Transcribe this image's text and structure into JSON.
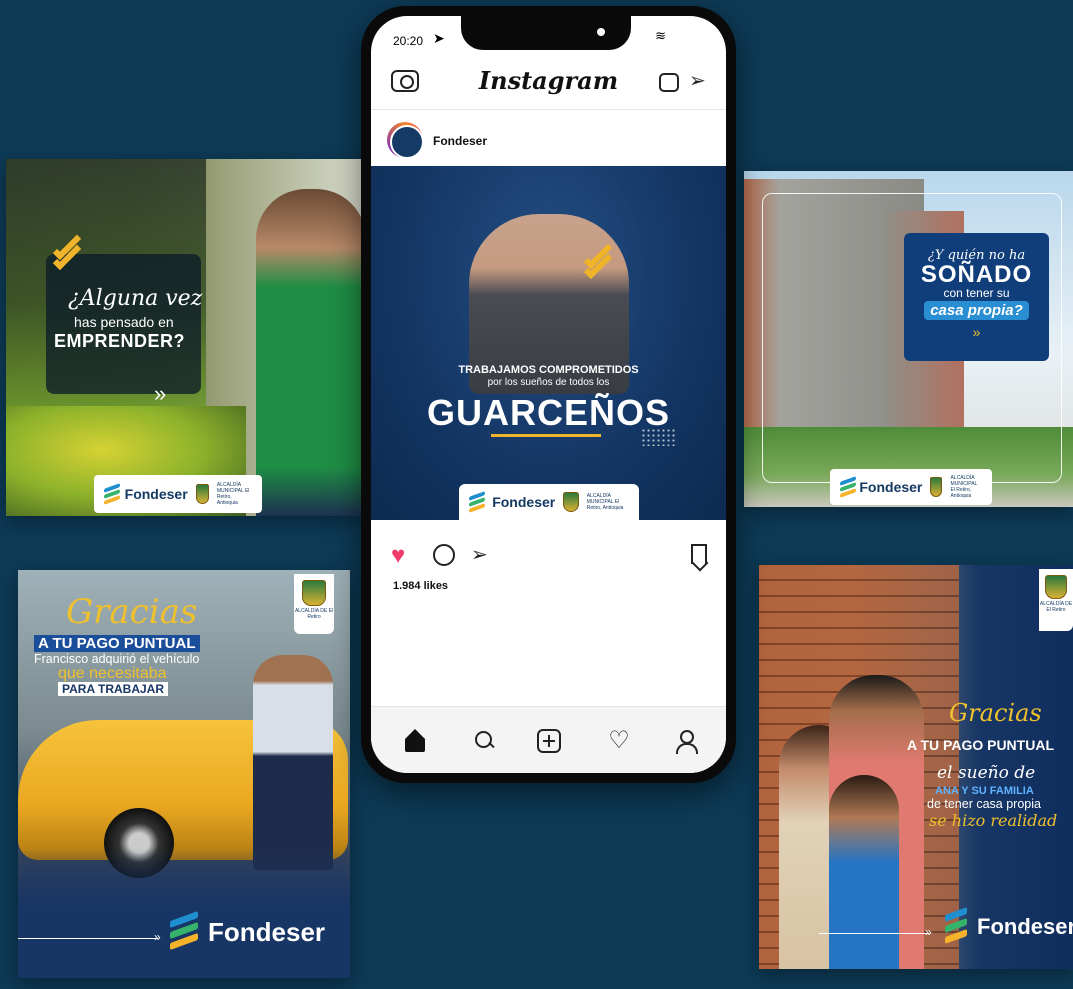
{
  "phone": {
    "status_time": "20:20",
    "app_title": "Instagram",
    "post": {
      "account": "Fondeser",
      "headline_1": "TRABAJAMOS COMPROMETIDOS",
      "headline_2": "por los sueños de todos los",
      "headline_3": "GUARCEÑOS",
      "brand": "Fondeser",
      "muni": "ALCALDÍA MUNICIPAL El Retiro, Antioquia"
    },
    "likes": "1.984 likes",
    "icons": [
      "camera-icon",
      "igtv-icon",
      "send-icon",
      "heart-icon",
      "comment-icon",
      "share-icon",
      "bookmark-icon",
      "home-icon",
      "search-icon",
      "add-icon",
      "activity-icon",
      "profile-icon"
    ]
  },
  "cards": {
    "emprender": {
      "line1": "¿Alguna vez",
      "line2": "has pensado en",
      "line3": "EMPRENDER?",
      "arrows": "»",
      "brand": "Fondeser",
      "muni": "ALCALDÍA MUNICIPAL El Retiro, Antioquia"
    },
    "taxi": {
      "gracias": "Gracias",
      "pago": "A TU PAGO PUNTUAL",
      "line1": "Francisco adquirió el vehículo",
      "line2": "que necesitaba",
      "line3": "PARA TRABAJAR",
      "brand": "Fondeser",
      "badge": "ALCALDÍA DE El Retiro"
    },
    "building": {
      "q": "¿Y quién no ha",
      "sonado": "SOÑADO",
      "con": "con tener su",
      "casa": "casa propia?",
      "arrows": "»",
      "brand": "Fondeser",
      "muni": "ALCALDÍA MUNICIPAL El Retiro, Antioquia"
    },
    "family": {
      "gracias": "Gracias",
      "pago": "A TU PAGO PUNTUAL",
      "line1": "el sueño de",
      "line2": "ANA Y SU FAMILIA",
      "line3": "de tener casa propia",
      "line4": "se hizo realidad",
      "brand": "Fondeser",
      "badge": "ALCALDÍA DE El Retiro"
    }
  },
  "colors": {
    "background": "#0d3a55",
    "brand_navy": "#143a63",
    "accent_gold": "#f0b42a",
    "like_red": "#ee3b6a"
  }
}
